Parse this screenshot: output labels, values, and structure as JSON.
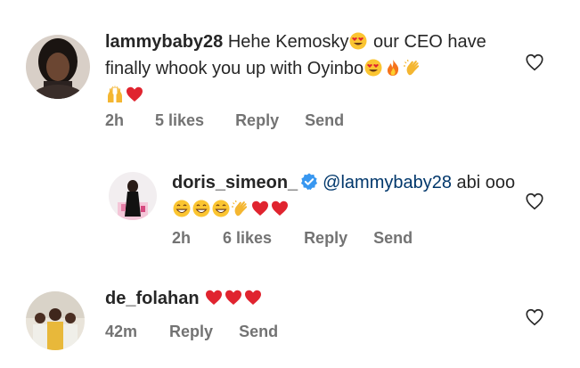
{
  "comments": [
    {
      "username": "lammybaby28",
      "text_part1": "Hehe Kemosky",
      "text_part2": " our CEO have finally whook you up with Oyinbo",
      "emojis_after_part1": [
        "heart-eyes"
      ],
      "emojis_after_part2": [
        "heart-eyes",
        "fire",
        "clapping-hands",
        "raising-hands",
        "red-heart"
      ],
      "time": "2h",
      "likes": "5 likes",
      "reply": "Reply",
      "send": "Send"
    },
    {
      "username": "doris_simeon_",
      "verified": true,
      "mention": "@lammybaby28",
      "text": " abi ooo",
      "emojis": [
        "grinning",
        "grinning",
        "grinning",
        "clapping-hands",
        "red-heart",
        "red-heart"
      ],
      "time": "2h",
      "likes": "6 likes",
      "reply": "Reply",
      "send": "Send"
    },
    {
      "username": "de_folahan",
      "emojis": [
        "red-heart",
        "red-heart",
        "red-heart"
      ],
      "time": "42m",
      "reply": "Reply",
      "send": "Send"
    }
  ],
  "colors": {
    "text": "#262626",
    "meta": "#737373",
    "mention": "#00376b",
    "verified": "#3897f0",
    "heart_red": "#e0242f"
  }
}
